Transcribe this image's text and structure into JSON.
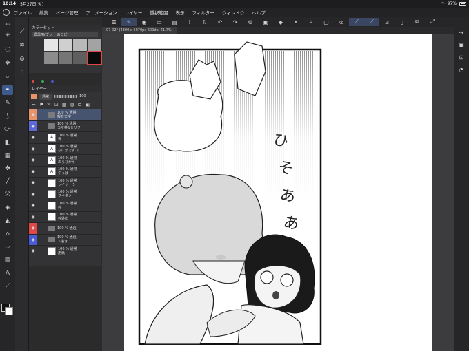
{
  "status": {
    "time": "18:14",
    "date": "5月27日(火)",
    "battery": "97%"
  },
  "menu": [
    "ファイル",
    "編集",
    "ページ管理",
    "アニメーション",
    "レイヤー",
    "選択範囲",
    "表示",
    "フィルター",
    "ウィンドウ",
    "ヘルプ"
  ],
  "document": {
    "tab_label": "07-02* (4300 x 6070px 600dpi 41.7%)"
  },
  "colorset": {
    "title": "カラーセット",
    "set_name": "濃黒用(グレー のコピー",
    "swatches": [
      "#e6e6e6",
      "#cfcfcf",
      "#b9b9b9",
      "#a3a3a3",
      "#8c8c8c",
      "#767676",
      "#5f5f5f",
      "#0a0a0a"
    ]
  },
  "layers": {
    "title": "レイヤー",
    "blend_mode": "通常",
    "opacity": "100",
    "rows": [
      {
        "label": "100 % 通過\n擬音文字",
        "type": "folder",
        "selected": true
      },
      {
        "label": "100 % 通過\nコマ枠&セリフ",
        "type": "folder",
        "selected": false
      },
      {
        "label": "100 % 通常\n汎",
        "type": "text",
        "selected": false
      },
      {
        "label": "100 % 通常\nなにがでずコ",
        "type": "text",
        "selected": false
      },
      {
        "label": "100 % 通常\nぬらひかゃ",
        "type": "text",
        "selected": false
      },
      {
        "label": "100 % 通常\nやっぱ",
        "type": "text",
        "selected": false
      },
      {
        "label": "100 % 通常\nレイヤー 5",
        "type": "raster",
        "selected": false
      },
      {
        "label": "100 % 通常\nフキダシ",
        "type": "raster",
        "selected": false
      },
      {
        "label": "100 % 通常\n枠",
        "type": "raster",
        "selected": false
      },
      {
        "label": "100 % 通常\n枠外応",
        "type": "raster",
        "selected": false
      },
      {
        "label": "100 % 通過\n",
        "type": "folder",
        "selected": false
      },
      {
        "label": "100 % 通過\n下描き",
        "type": "folder",
        "selected": false
      },
      {
        "label": "100 % 通常\n用紙",
        "type": "paper",
        "selected": false
      }
    ]
  },
  "colors": {
    "accent": "#3d5a8c",
    "selected_layer": "#46546f",
    "red_mark": "#e04848",
    "blue_mark": "#4a5bd6"
  }
}
